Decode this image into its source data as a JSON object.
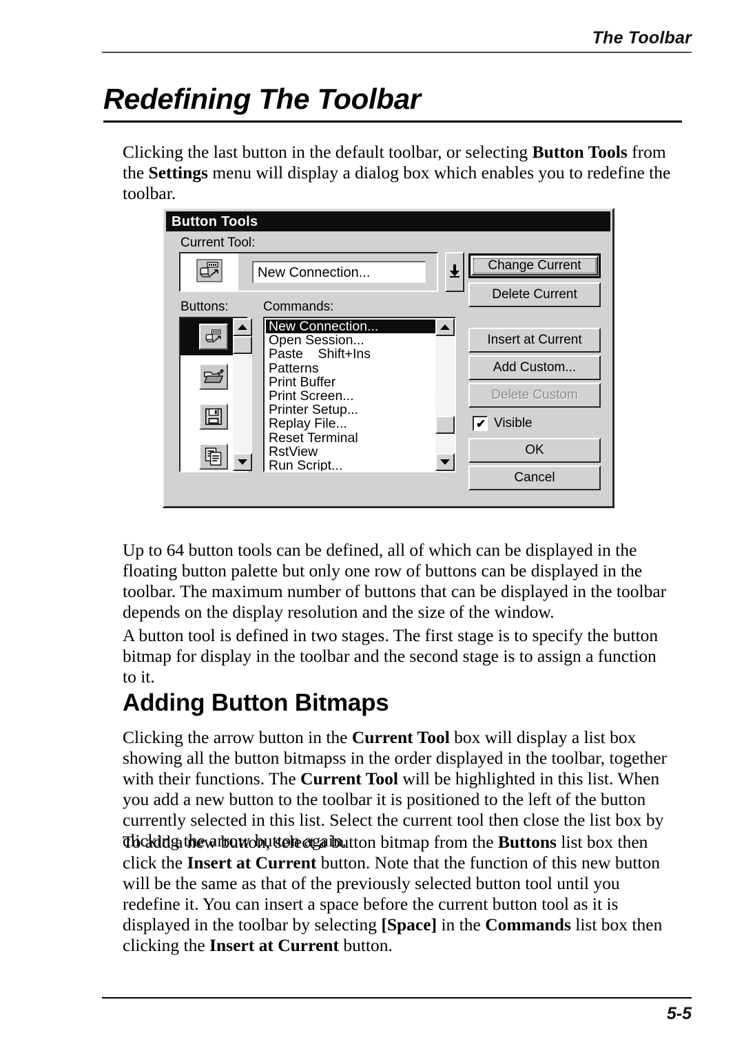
{
  "header": {
    "running_head": "The Toolbar"
  },
  "title": "Redefining The Toolbar",
  "footer": {
    "page_number": "5-5"
  },
  "intro_paragraph": {
    "part1": "Clicking the last button in the default toolbar, or selecting ",
    "bold1": "Button Tools",
    "part2": " from the ",
    "bold2": "Settings",
    "part3": " menu will display a dialog box which enables you to redefine the toolbar."
  },
  "paragraph_after_figure": "Up to 64 button tools can be defined, all of which can be displayed in the floating button palette but only one row of buttons can be displayed in the toolbar. The maximum number of buttons that can be displayed in the toolbar depends on the display resolution and the size of the window.",
  "paragraph_two_stages": "A button tool is defined in two stages. The first stage is to specify the button bitmap for display in the toolbar and the second stage is to assign a function to it.",
  "section_heading": "Adding Button Bitmaps",
  "paragraph_arrow_button": {
    "part1": "Clicking the arrow button in the ",
    "bold1": "Current Tool",
    "part2": " box will display a list box showing all the button bitmapss in the order displayed in the toolbar, together with their functions. The ",
    "bold2": "Current Tool",
    "part3": " will be highlighted in this list. When you add a new button to the toolbar it is positioned to the left of the button currently selected in this list. Select the current tool then close the list box by clicking the arrow button again."
  },
  "paragraph_add_button": {
    "part1": "To add a new button, select a button bitmap from the ",
    "bold1": "Buttons",
    "part2": " list box then click the ",
    "bold2": "Insert at Current",
    "part3": " button. Note that the function of this new button will be the same as that of the previously selected button tool until you redefine it. You can insert a space before the current button tool as it is displayed in the toolbar by selecting ",
    "bold3": "[Space]",
    "part4": " in the ",
    "bold4": "Commands",
    "part5": " list box then clicking the ",
    "bold5": "Insert at Current",
    "part6": " button."
  },
  "dialog": {
    "title": "Button Tools",
    "current_tool": {
      "label": "Current Tool:",
      "value": "New Connection...",
      "icon": "new-connection-icon",
      "spinner_icon": "arrow-down-icon"
    },
    "buttons_list": {
      "label": "Buttons:",
      "items": [
        {
          "icon": "new-connection-icon",
          "selected": true
        },
        {
          "icon": "open-folder-icon",
          "selected": false
        },
        {
          "icon": "floppy-save-icon",
          "selected": false
        },
        {
          "icon": "copy-documents-icon",
          "selected": false
        }
      ],
      "scroll_up_icon": "triangle-up-icon",
      "scroll_down_icon": "triangle-down-icon"
    },
    "commands_list": {
      "label": "Commands:",
      "items": [
        "New Connection...",
        "Open Session...",
        "Paste    Shift+Ins",
        "Patterns",
        "Print Buffer",
        "Print Screen...",
        "Printer Setup...",
        "Replay File...",
        "Reset Terminal",
        "RstView",
        "Run Script..."
      ],
      "selected_index": 0,
      "scroll_up_icon": "triangle-up-icon",
      "scroll_down_icon": "triangle-down-icon"
    },
    "action_buttons": [
      {
        "label": "Change Current",
        "state": "default"
      },
      {
        "label": "Delete Current",
        "state": "enabled"
      },
      {
        "label": "Insert at Current",
        "state": "enabled"
      },
      {
        "label": "Add Custom...",
        "state": "enabled"
      },
      {
        "label": "Delete Custom",
        "state": "disabled"
      },
      {
        "label": "OK",
        "state": "enabled"
      },
      {
        "label": "Cancel",
        "state": "enabled"
      }
    ],
    "visible_checkbox": {
      "label": "Visible",
      "checked": true
    }
  }
}
